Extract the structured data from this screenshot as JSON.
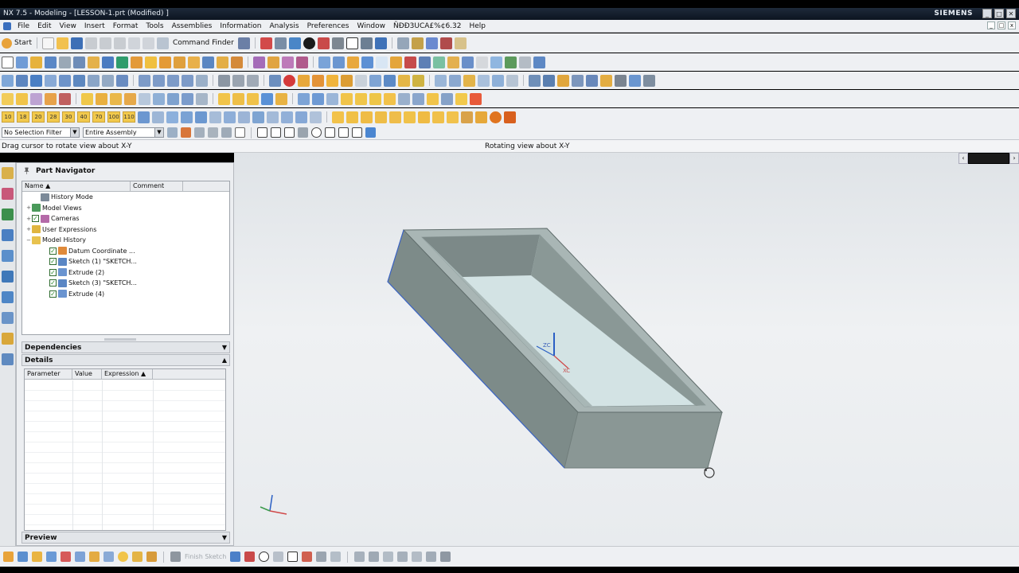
{
  "window": {
    "title": "NX 7.5 - Modeling - [LESSON-1.prt (Modified) ]",
    "brand": "SIEMENS",
    "min_label": "_",
    "max_label": "□",
    "close_label": "✕"
  },
  "menu": {
    "items": [
      {
        "label": "File",
        "key": "F"
      },
      {
        "label": "Edit",
        "key": "E"
      },
      {
        "label": "View",
        "key": "V"
      },
      {
        "label": "Insert",
        "key": "I"
      },
      {
        "label": "Format",
        "key": "F"
      },
      {
        "label": "Tools",
        "key": "T"
      },
      {
        "label": "Assemblies",
        "key": "A"
      },
      {
        "label": "Information",
        "key": "I"
      },
      {
        "label": "Analysis",
        "key": "A"
      },
      {
        "label": "Preferences",
        "key": "P"
      },
      {
        "label": "Window",
        "key": "W"
      },
      {
        "label": "ÑÐÐ3UCA£%¢6.32",
        "key": ""
      },
      {
        "label": "Help",
        "key": "H"
      }
    ]
  },
  "toolbar": {
    "start_label": "Start",
    "command_finder_label": "Command Finder",
    "numbers": [
      "10",
      "18",
      "20",
      "28",
      "30",
      "40",
      "70",
      "100",
      "110"
    ]
  },
  "selection": {
    "filter_value": "No Selection Filter",
    "scope_value": "Entire Assembly"
  },
  "cue": {
    "left_text": "Drag cursor to rotate view about X-Y",
    "center_text": "Rotating view about X-Y"
  },
  "navigator": {
    "title": "Part Navigator",
    "columns": [
      "Name",
      "Comment"
    ],
    "rows": [
      {
        "label": "History Mode",
        "level": 1,
        "expander": "",
        "icon": "clock-icon",
        "checked": false
      },
      {
        "label": "Model Views",
        "level": 0,
        "expander": "+",
        "icon": "views-icon",
        "checked": false
      },
      {
        "label": "Cameras",
        "level": 0,
        "expander": "+",
        "icon": "camera-icon",
        "checked": true
      },
      {
        "label": "User Expressions",
        "level": 0,
        "expander": "+",
        "icon": "folder-icon",
        "checked": false
      },
      {
        "label": "Model History",
        "level": 0,
        "expander": "−",
        "icon": "folder-open-icon",
        "checked": false
      },
      {
        "label": "Datum Coordinate ...",
        "level": 2,
        "expander": "",
        "icon": "datum-csys-icon",
        "checked": true
      },
      {
        "label": "Sketch (1) \"SKETCH...",
        "level": 2,
        "expander": "",
        "icon": "sketch-icon",
        "checked": true
      },
      {
        "label": "Extrude (2)",
        "level": 2,
        "expander": "",
        "icon": "extrude-icon",
        "checked": true
      },
      {
        "label": "Sketch (3) \"SKETCH...",
        "level": 2,
        "expander": "",
        "icon": "sketch-icon",
        "checked": true
      },
      {
        "label": "Extrude (4)",
        "level": 2,
        "expander": "",
        "icon": "extrude-icon",
        "checked": true
      }
    ],
    "dependencies_label": "Dependencies",
    "details_label": "Details",
    "details_columns": [
      "Parameter",
      "Value",
      "Expression"
    ],
    "preview_label": "Preview"
  },
  "bottom": {
    "finish_sketch_label": "Finish Sketch"
  },
  "colors": {
    "accent": "#2a64b8",
    "model_top": "#9aa7a5",
    "model_side": "#7f8c8a",
    "model_inner": "#cfe0e1"
  }
}
